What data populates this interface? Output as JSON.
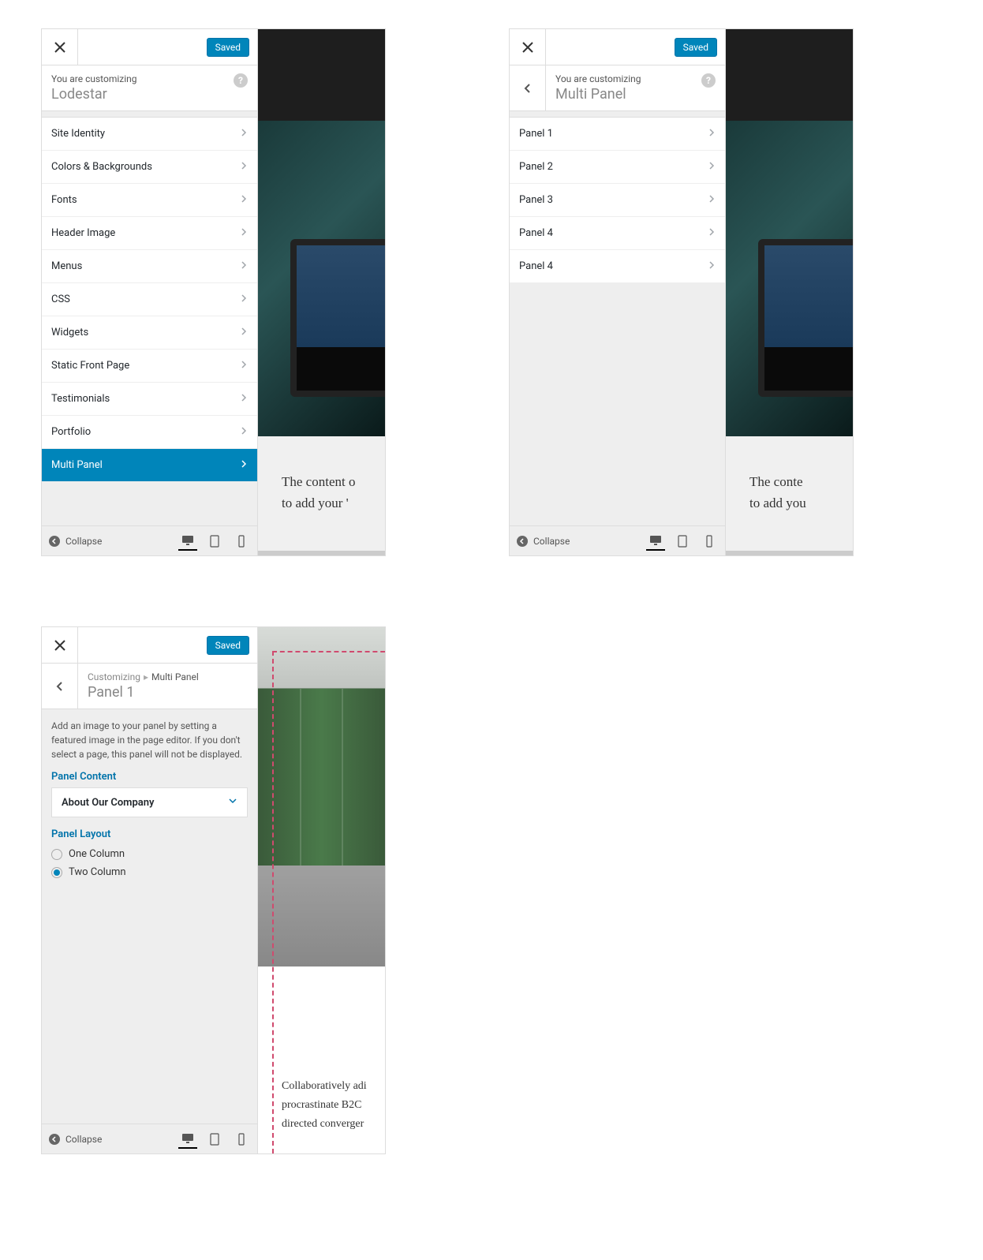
{
  "shared": {
    "saved": "Saved",
    "collapse": "Collapse",
    "customizing_label": "You are customizing",
    "help": "?"
  },
  "s1": {
    "title": "Lodestar",
    "menu": [
      "Site Identity",
      "Colors & Backgrounds",
      "Fonts",
      "Header Image",
      "Menus",
      "CSS",
      "Widgets",
      "Static Front Page",
      "Testimonials",
      "Portfolio",
      "Multi Panel"
    ],
    "active_index": 10,
    "preview_lines": [
      "The content o",
      "to add your '"
    ]
  },
  "s2": {
    "title": "Multi Panel",
    "menu": [
      "Panel 1",
      "Panel 2",
      "Panel 3",
      "Panel 4",
      "Panel 4"
    ],
    "preview_lines": [
      "The conte",
      "to add you"
    ]
  },
  "s3": {
    "breadcrumb_root": "Customizing",
    "breadcrumb_parent": "Multi Panel",
    "title": "Panel 1",
    "description": "Add an image to your panel by setting a featured image in the page editor. If you don't select a page, this panel will not be displayed.",
    "panel_content_label": "Panel Content",
    "panel_content_value": "About Our Company",
    "panel_layout_label": "Panel Layout",
    "layout_options": [
      "One Column",
      "Two Column"
    ],
    "layout_selected": 1,
    "preview_lines": [
      "Collaboratively adi",
      "procrastinate B2C",
      "directed converger"
    ]
  }
}
